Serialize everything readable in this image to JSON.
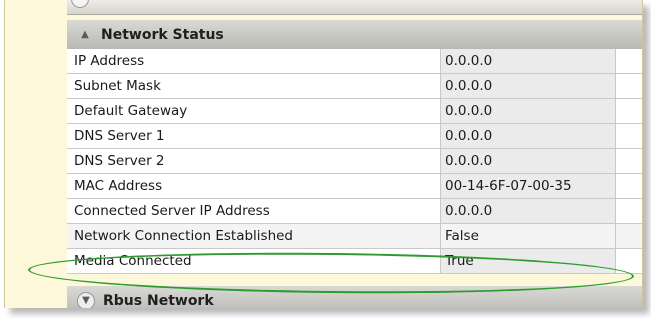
{
  "network_status": {
    "title": "Network Status",
    "rows": [
      {
        "label": "IP Address",
        "value": "0.0.0.0"
      },
      {
        "label": "Subnet Mask",
        "value": "0.0.0.0"
      },
      {
        "label": "Default Gateway",
        "value": "0.0.0.0"
      },
      {
        "label": "DNS Server 1",
        "value": "0.0.0.0"
      },
      {
        "label": "DNS Server 2",
        "value": "0.0.0.0"
      },
      {
        "label": "MAC Address",
        "value": "00-14-6F-07-00-35"
      },
      {
        "label": "Connected Server IP Address",
        "value": "0.0.0.0"
      },
      {
        "label": "Network Connection Established",
        "value": "False"
      },
      {
        "label": "Media Connected",
        "value": "True"
      }
    ]
  },
  "rbus_network": {
    "title": "Rbus Network"
  },
  "icons": {
    "collapse": "chevron-up-icon",
    "expand": "chevron-down-icon"
  },
  "colors": {
    "highlight": "#2f9b2f",
    "value_cell_bg": "#ebebeb",
    "header_bg": "#c9c8c2",
    "frame_bg": "#fdf8d9"
  }
}
